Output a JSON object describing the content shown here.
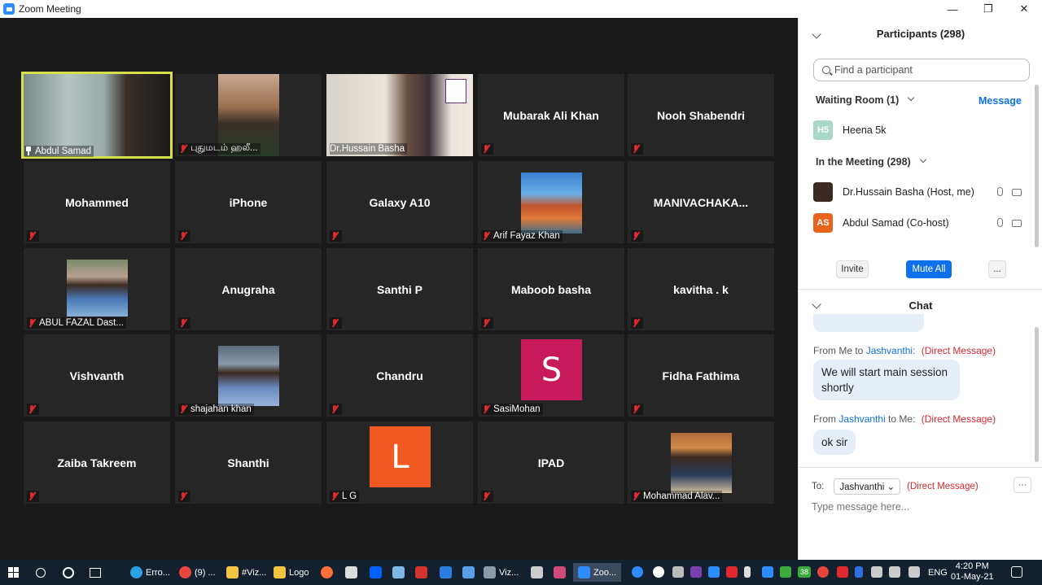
{
  "window": {
    "title": "Zoom Meeting",
    "minimize": "—",
    "restore": "❐",
    "close": "✕"
  },
  "tiles": [
    {
      "name": "Abdul Samad",
      "kind": "video",
      "pinned": true,
      "active": true
    },
    {
      "name": "புதுமடம் ஹலீ...",
      "kind": "video"
    },
    {
      "name": "Dr.Hussain Basha",
      "kind": "video",
      "no_mic_icon": true
    },
    {
      "name": "Mubarak Ali Khan",
      "kind": "text"
    },
    {
      "name": "Nooh Shabendri",
      "kind": "text"
    },
    {
      "name": "Mohammed",
      "kind": "text"
    },
    {
      "name": "iPhone",
      "kind": "text"
    },
    {
      "name": "Galaxy A10",
      "kind": "text"
    },
    {
      "name": "Arif Fayaz Khan",
      "kind": "photo"
    },
    {
      "name": "MANIVACHAKA...",
      "kind": "text"
    },
    {
      "name": "ABUL FAZAL Dast...",
      "kind": "photo"
    },
    {
      "name": "Anugraha",
      "kind": "text"
    },
    {
      "name": "Santhi P",
      "kind": "text"
    },
    {
      "name": "Maboob basha",
      "kind": "text"
    },
    {
      "name": "kavitha . k",
      "kind": "text"
    },
    {
      "name": "Vishvanth",
      "kind": "text"
    },
    {
      "name": "shajahan khan",
      "kind": "photo"
    },
    {
      "name": "Chandru",
      "kind": "text"
    },
    {
      "name": "SasiMohan",
      "kind": "letter",
      "letter": "S",
      "color": "#c8195a"
    },
    {
      "name": "Fidha Fathima",
      "kind": "text"
    },
    {
      "name": "Zaiba Takreem",
      "kind": "text"
    },
    {
      "name": "Shanthi",
      "kind": "text"
    },
    {
      "name": "L G",
      "kind": "letter",
      "letter": "L",
      "color": "#f05a22"
    },
    {
      "name": "IPAD",
      "kind": "text"
    },
    {
      "name": "Mohammad Alav...",
      "kind": "photo"
    }
  ],
  "participants": {
    "title": "Participants (298)",
    "search_placeholder": "Find a participant",
    "waiting_room_label": "Waiting Room (1)",
    "message_link": "Message",
    "waiting": [
      {
        "initials": "H5",
        "name": "Heena 5k",
        "color": "#a9d8c6"
      }
    ],
    "in_meeting_label": "In the Meeting (298)",
    "members": [
      {
        "initials": "",
        "name": "Dr.Hussain Basha (Host, me)",
        "color": "#3a2a22"
      },
      {
        "initials": "AS",
        "name": "Abdul Samad (Co-host)",
        "color": "#e8641c"
      }
    ],
    "buttons": {
      "invite": "Invite",
      "mute_all": "Mute All",
      "more": "..."
    }
  },
  "chat": {
    "title": "Chat",
    "messages": [
      {
        "from": "From Me to ",
        "name": "Jashvanthi",
        "suffix": ":",
        "dm": "(Direct Message)",
        "text": "We will start main session shortly"
      },
      {
        "from": "From ",
        "name": "Jashvanthi",
        "suffix": " to Me:",
        "dm": "(Direct Message)",
        "text": "ok sir"
      }
    ],
    "to_label": "To:",
    "to_value": "Jashvanthi ⌄",
    "to_dm": "(Direct Message)",
    "more": "···",
    "input_placeholder": "Type message here..."
  },
  "taskbar": {
    "items": [
      "Erro...",
      "(9) ...",
      "#Viz...",
      "Logo",
      "Viz...",
      "Zoo..."
    ],
    "lang": "ENG",
    "time": "4:20 PM",
    "date": "01-May-21",
    "tray_number": "38"
  },
  "colors": {
    "brand": "#0e71eb",
    "mute": "#e0282f",
    "active_speaker": "#d6e04a"
  }
}
